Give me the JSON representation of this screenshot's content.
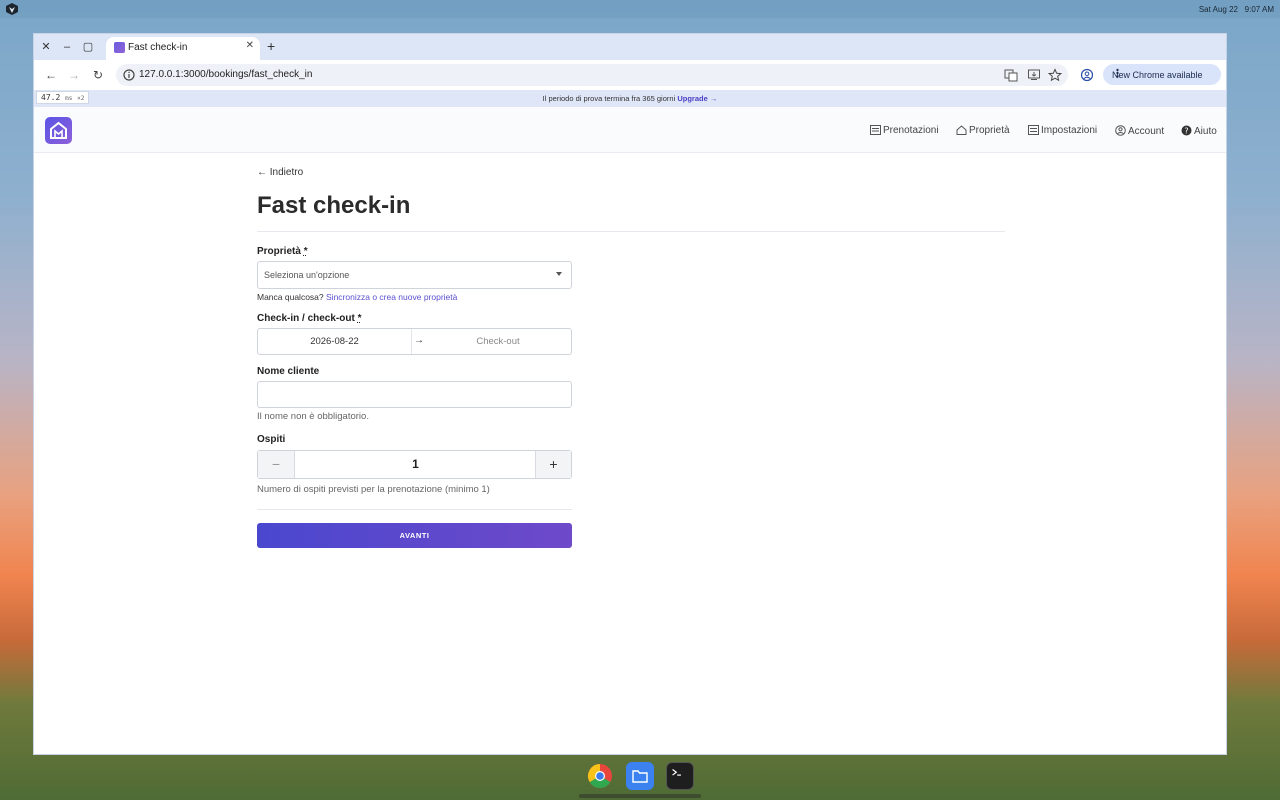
{
  "system": {
    "date": "Sat Aug 22",
    "time": "9:07 AM"
  },
  "browser": {
    "tab_title": "Fast check-in",
    "url": "127.0.0.1:3000/bookings/fast_check_in",
    "new_chrome_label": "New Chrome available",
    "perf_value": "47.2",
    "perf_unit": "ms",
    "perf_multiplier": "×2"
  },
  "trial": {
    "text": "Il periodo di prova termina fra 365 giorni",
    "upgrade": "Upgrade →"
  },
  "nav": {
    "bookings": "Prenotazioni",
    "properties": "Proprietà",
    "settings": "Impostazioni",
    "account": "Account",
    "help": "Aiuto"
  },
  "page": {
    "back": "Indietro",
    "title": "Fast check-in",
    "property_label": "Proprietà",
    "property_placeholder": "Seleziona un'opzione",
    "property_hint": "Manca qualcosa?",
    "property_hint_link": "Sincronizza o crea nuove proprietà",
    "dates_label": "Check-in / check-out",
    "checkin_value": "2026-08-22",
    "checkout_placeholder": "Check-out",
    "name_label": "Nome cliente",
    "name_value": "",
    "name_help": "Il nome non è obbligatorio.",
    "guests_label": "Ospiti",
    "guests_value": "1",
    "guests_minus": "−",
    "guests_plus": "+",
    "guests_help": "Numero di ospiti previsti per la prenotazione (minimo 1)",
    "required_marker": "*",
    "submit": "AVANTI"
  },
  "colors": {
    "accent": "#5a4fd0",
    "button": "#4a48cf"
  }
}
